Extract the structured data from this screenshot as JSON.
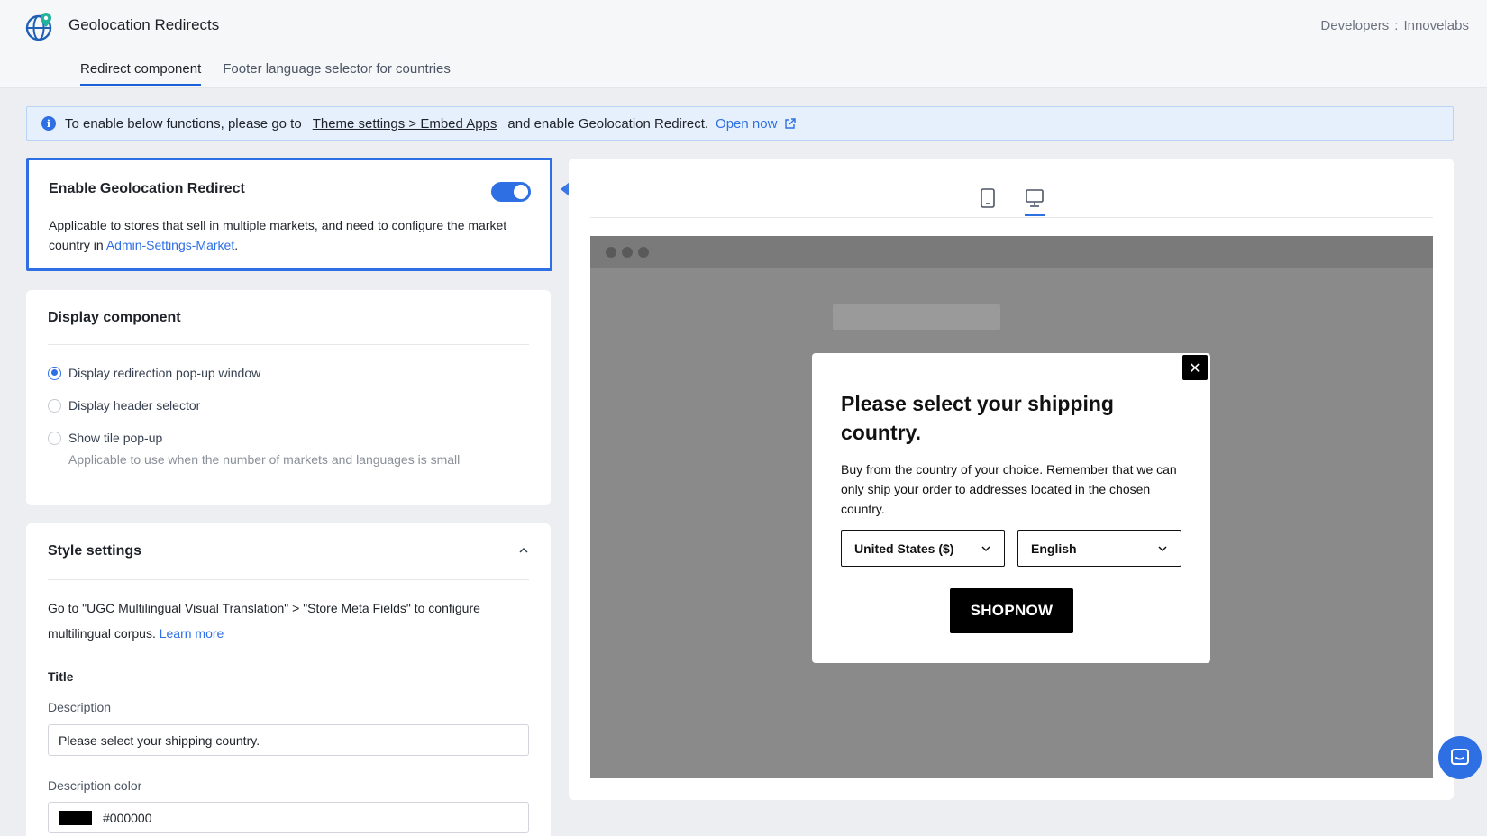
{
  "header": {
    "app_title": "Geolocation Redirects",
    "developers_label": "Developers",
    "separator": ":",
    "developer_name": "Innovelabs",
    "tabs": [
      {
        "label": "Redirect component",
        "active": true
      },
      {
        "label": "Footer language selector for countries",
        "active": false
      }
    ]
  },
  "banner": {
    "prefix": "To enable below functions, please go to",
    "link": "Theme settings > Embed Apps",
    "suffix": "and enable Geolocation Redirect.",
    "open_now": "Open now"
  },
  "enable_card": {
    "title": "Enable Geolocation Redirect",
    "toggle_on": true,
    "desc_prefix": "Applicable to stores that sell in multiple markets, and need to configure the market country in",
    "desc_link": "Admin-Settings-Market",
    "desc_suffix": "."
  },
  "display_component": {
    "title": "Display component",
    "options": [
      {
        "label": "Display redirection pop-up window",
        "checked": true
      },
      {
        "label": "Display header selector",
        "checked": false
      },
      {
        "label": "Show tile pop-up",
        "checked": false
      }
    ],
    "tile_hint": "Applicable to use when the number of markets and languages is small"
  },
  "style_settings": {
    "title": "Style settings",
    "desc": "Go to \"UGC Multilingual Visual Translation\" > \"Store Meta Fields\" to configure multilingual corpus.",
    "learn_more": "Learn more",
    "title_label": "Title",
    "description_label": "Description",
    "description_value": "Please select your shipping country.",
    "description_color_label": "Description color",
    "description_color_value": "#000000"
  },
  "preview": {
    "popup_title": "Please select your shipping country.",
    "popup_desc": "Buy from the country of your choice. Remember that we can only ship your order to addresses located in the chosen country.",
    "country_select": "United States ($)",
    "language_select": "English",
    "shop_button": "SHOPNOW",
    "close_glyph": "✕"
  },
  "colors": {
    "accent": "#2f6fe4",
    "preview_bg": "#8a8a8a",
    "button_bg": "#000000"
  }
}
